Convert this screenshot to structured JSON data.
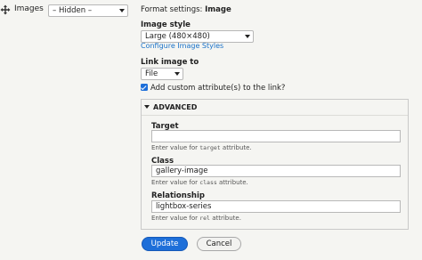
{
  "row": {
    "field_label": "Images",
    "visibility_value": "– Hidden –"
  },
  "format": {
    "prefix": "Format settings: ",
    "name": "Image",
    "image_style_label": "Image style",
    "image_style_value": "Large (480×480)",
    "configure_link": "Configure Image Styles",
    "link_image_label": "Link image to",
    "link_image_value": "File",
    "custom_attr_label": "Add custom attribute(s) to the link?",
    "custom_attr_checked": true
  },
  "advanced": {
    "title": "ADVANCED",
    "target": {
      "label": "Target",
      "value": "",
      "hint_pre": "Enter value for ",
      "hint_code": "target",
      "hint_post": " attribute."
    },
    "class": {
      "label": "Class",
      "value": "gallery-image",
      "hint_pre": "Enter value for ",
      "hint_code": "class",
      "hint_post": " attribute."
    },
    "relationship": {
      "label": "Relationship",
      "value": "lightbox-series",
      "hint_pre": "Enter value for ",
      "hint_code": "rel",
      "hint_post": " attribute."
    }
  },
  "actions": {
    "update": "Update",
    "cancel": "Cancel"
  },
  "colors": {
    "accent": "#1e6fd9",
    "link": "#1a72c9",
    "background": "#f5f5f2"
  },
  "icons": {
    "drag": "drag-handle-icon",
    "collapse": "triangle-down-icon",
    "check": "checkbox-checked-icon"
  }
}
